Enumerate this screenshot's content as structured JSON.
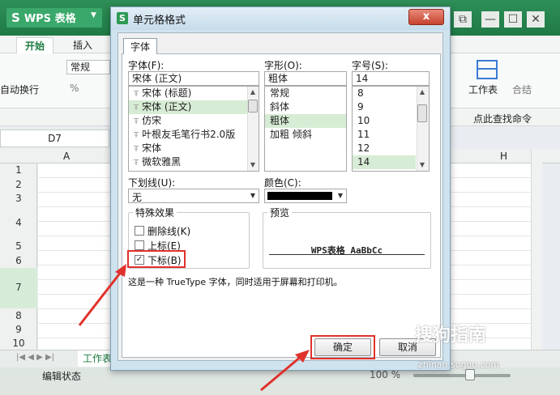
{
  "app": {
    "logo": "WPS 表格",
    "tabs": [
      "开始",
      "插入"
    ],
    "ribbon": {
      "style_value": "常规",
      "wrap_label": "自动换行",
      "percent_label": "%",
      "worksheet_label": "工作表",
      "merge_label": "合结",
      "find_cmd_label": "点此查找命令"
    },
    "name_box": "D7",
    "columns": [
      "A",
      "H"
    ],
    "rows": [
      "1",
      "2",
      "3",
      "4",
      "5",
      "6",
      "7",
      "8",
      "9",
      "10"
    ],
    "sheet_tab": "工作表",
    "status": "编辑状态",
    "zoom": "100 %"
  },
  "dialog": {
    "title": "单元格格式",
    "close_label": "x",
    "tab_label": "字体",
    "font": {
      "label": "字体(F):",
      "value": "宋体 (正文)",
      "items": [
        "宋体 (标题)",
        "宋体 (正文)",
        "仿宋",
        "叶根友毛笔行书2.0版",
        "宋体",
        "微软雅黑"
      ],
      "selected_index": 1
    },
    "style": {
      "label": "字形(O):",
      "value": "粗体",
      "items": [
        "常规",
        "斜体",
        "粗体",
        "加粗 倾斜"
      ],
      "selected_index": 2
    },
    "size": {
      "label": "字号(S):",
      "value": "14",
      "items": [
        "8",
        "9",
        "10",
        "11",
        "12",
        "14"
      ],
      "selected_index": 5
    },
    "underline": {
      "label": "下划线(U):",
      "value": "无"
    },
    "color": {
      "label": "颜色(C):",
      "value_color": "#000000"
    },
    "effects": {
      "title": "特殊效果",
      "strikethrough": {
        "label": "删除线(K)",
        "checked": false
      },
      "superscript": {
        "label": "上标(E)",
        "checked": false
      },
      "subscript": {
        "label": "下标(B)",
        "checked": true
      }
    },
    "preview": {
      "title": "预览",
      "text": "WPS表格  AaBbCc"
    },
    "description": "这是一种 TrueType 字体，同时适用于屏幕和打印机。",
    "ok_label": "确定",
    "cancel_label": "取消"
  },
  "watermark": {
    "text": "搜狗指南",
    "url": "zhinan.sogou.com"
  },
  "colors": {
    "brand_green": "#1f7a45",
    "highlight": "#e0322c",
    "selection": "#d7ecd4"
  }
}
